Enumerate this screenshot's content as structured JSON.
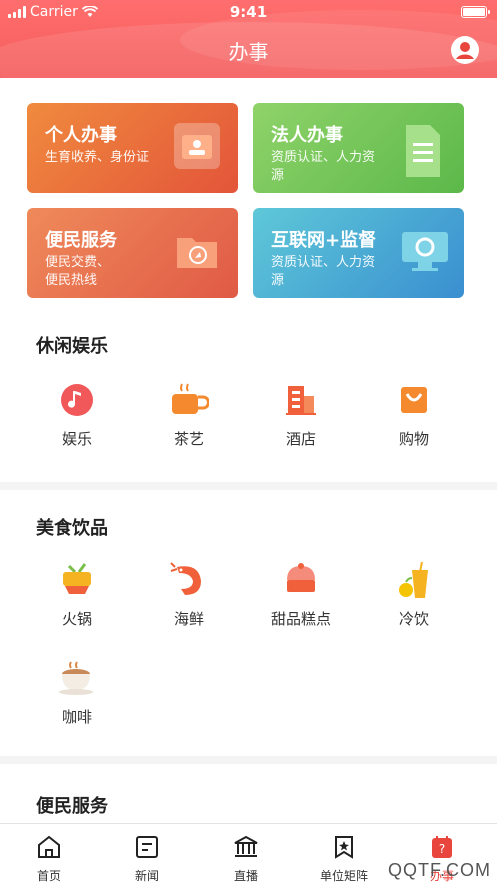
{
  "status_bar": {
    "carrier": "Carrier",
    "time": "9:41"
  },
  "header": {
    "title": "办事"
  },
  "service_tiles": [
    {
      "title": "个人办事",
      "subtitle": "生育收养、身份证",
      "color_from": "#f08a3e",
      "color_to": "#e3553a",
      "icon": "id-card-icon"
    },
    {
      "title": "法人办事",
      "subtitle": "资质认证、人力资源",
      "color_from": "#8fd36a",
      "color_to": "#5cb84a",
      "icon": "document-icon"
    },
    {
      "title": "便民服务",
      "subtitle": "便民交费、便民热线",
      "color_from": "#ef8a5a",
      "color_to": "#e05a45",
      "icon": "folder-icon"
    },
    {
      "title": "互联网+监督",
      "subtitle": "资质认证、人力资源",
      "color_from": "#5ec8d8",
      "color_to": "#3a8fd0",
      "icon": "monitor-icon"
    }
  ],
  "leisure": {
    "title": "休闲娱乐",
    "items": [
      {
        "label": "娱乐",
        "icon": "music-icon"
      },
      {
        "label": "茶艺",
        "icon": "tea-cup-icon"
      },
      {
        "label": "酒店",
        "icon": "hotel-building-icon"
      },
      {
        "label": "购物",
        "icon": "shopping-bag-icon"
      }
    ]
  },
  "food": {
    "title": "美食饮品",
    "items": [
      {
        "label": "火锅",
        "icon": "hotpot-icon"
      },
      {
        "label": "海鲜",
        "icon": "shrimp-icon"
      },
      {
        "label": "甜品糕点",
        "icon": "cake-icon"
      },
      {
        "label": "冷饮",
        "icon": "cold-drink-icon"
      },
      {
        "label": "咖啡",
        "icon": "coffee-icon"
      }
    ]
  },
  "convenience": {
    "title": "便民服务"
  },
  "tabbar": {
    "items": [
      {
        "label": "首页",
        "icon": "home-icon"
      },
      {
        "label": "新闻",
        "icon": "news-icon"
      },
      {
        "label": "直播",
        "icon": "live-icon"
      },
      {
        "label": "单位矩阵",
        "icon": "matrix-icon"
      },
      {
        "label": "办事",
        "icon": "service-icon"
      }
    ],
    "active_color": "#e8453c"
  },
  "watermark": "QQTF.COM"
}
